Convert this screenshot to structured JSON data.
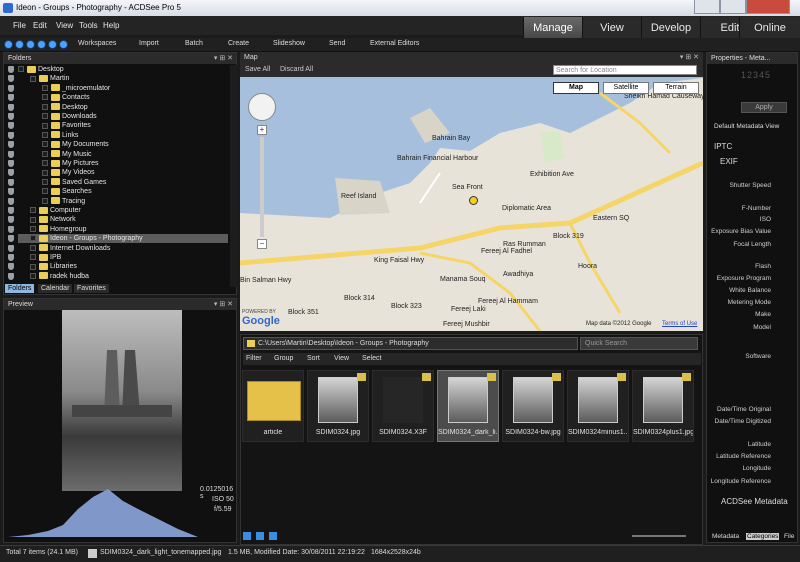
{
  "window": {
    "title": "Ideon - Groups - Photography - ACDSee Pro 5"
  },
  "menu": [
    "File",
    "Edit",
    "View",
    "Tools",
    "Help"
  ],
  "modes": [
    "Manage",
    "View",
    "Develop",
    "Edit",
    "Online"
  ],
  "toolbar": [
    "Workspaces",
    "Import",
    "Batch",
    "Create",
    "Slideshow",
    "Send",
    "External Editors"
  ],
  "folders": {
    "title": "Folders",
    "tree": [
      "Desktop",
      "Martin",
      "_microemulator",
      "Contacts",
      "Desktop",
      "Downloads",
      "Favorites",
      "Links",
      "My Documents",
      "My Music",
      "My Pictures",
      "My Videos",
      "Saved Games",
      "Searches",
      "Tracing",
      "Computer",
      "Network",
      "Homegroup",
      "Ideon - Groups - Photography",
      "Internet Downloads",
      "IPB",
      "Libraries",
      "radek hudba"
    ],
    "tabs": [
      "Folders",
      "Calendar",
      "Favorites"
    ]
  },
  "preview": {
    "title": "Preview",
    "exposure": "0.0125016 s",
    "iso": "ISO 50",
    "aperture": "f/5.59"
  },
  "map": {
    "title": "Map",
    "save_all": "Save All",
    "discard_all": "Discard All",
    "search_placeholder": "Search for Location",
    "types": [
      "Map",
      "Satellite",
      "Terrain"
    ],
    "labels": [
      "Bahrain Bay",
      "Bahrain Financial Harbour",
      "Reef Island",
      "Sea Front",
      "Diplomatic Area",
      "Fereej Al Fadhel",
      "Ras Rumman",
      "Block 319",
      "Eastern SQ",
      "Hoora",
      "Manama Souq",
      "Awadhiya",
      "Fereej Al Hammam",
      "Fereej Laki",
      "Fereej Mushbir",
      "Block 314",
      "Block 323",
      "Block 351",
      "King Faisal Hwy",
      "Bin Salman Hwy",
      "Sheikh Hamad Causeway",
      "Exhibition Ave"
    ],
    "copyright": "Map data ©2012 Google",
    "terms": "Terms of Use",
    "powered": "POWERED BY",
    "google": "Google"
  },
  "browser": {
    "path": "C:\\Users\\Martin\\Desktop\\Ideon - Groups - Photography",
    "search_placeholder": "Quick Search",
    "filters": [
      "Filter",
      "Group",
      "Sort",
      "View",
      "Select"
    ],
    "files": [
      "article",
      "SDIM0324.jpg",
      "SDIM0324.X3F",
      "SDIM0324_dark_li...",
      "SDIM0324-bw.jpg",
      "SDIM0324minus1...",
      "SDIM0324plus1.jpg"
    ]
  },
  "properties": {
    "title": "Properties - Meta...",
    "apply": "Apply",
    "view": "Default Metadata View",
    "sections": [
      "IPTC",
      "EXIF",
      "ACDSee Metadata"
    ],
    "exif_fields": [
      "Shutter Speed",
      "F-Number",
      "ISO",
      "Exposure Bias Value",
      "Focal Length",
      "Flash",
      "Exposure Program",
      "White Balance",
      "Metering Mode",
      "Make",
      "Model",
      "Software",
      "Date/Time Original",
      "Date/Time Digitized",
      "Latitude",
      "Latitude Reference",
      "Longitude",
      "Longitude Reference"
    ],
    "tabs": [
      "Metadata",
      "Categories",
      "File"
    ],
    "counter": "12345"
  },
  "status": {
    "total": "Total 7 items  (24.1 MB)",
    "file": "SDIM0324_dark_light_tonemapped.jpg",
    "info": "1.5 MB, Modified Date: 30/08/2011 22:19:22",
    "dims": "1684x2528x24b"
  }
}
